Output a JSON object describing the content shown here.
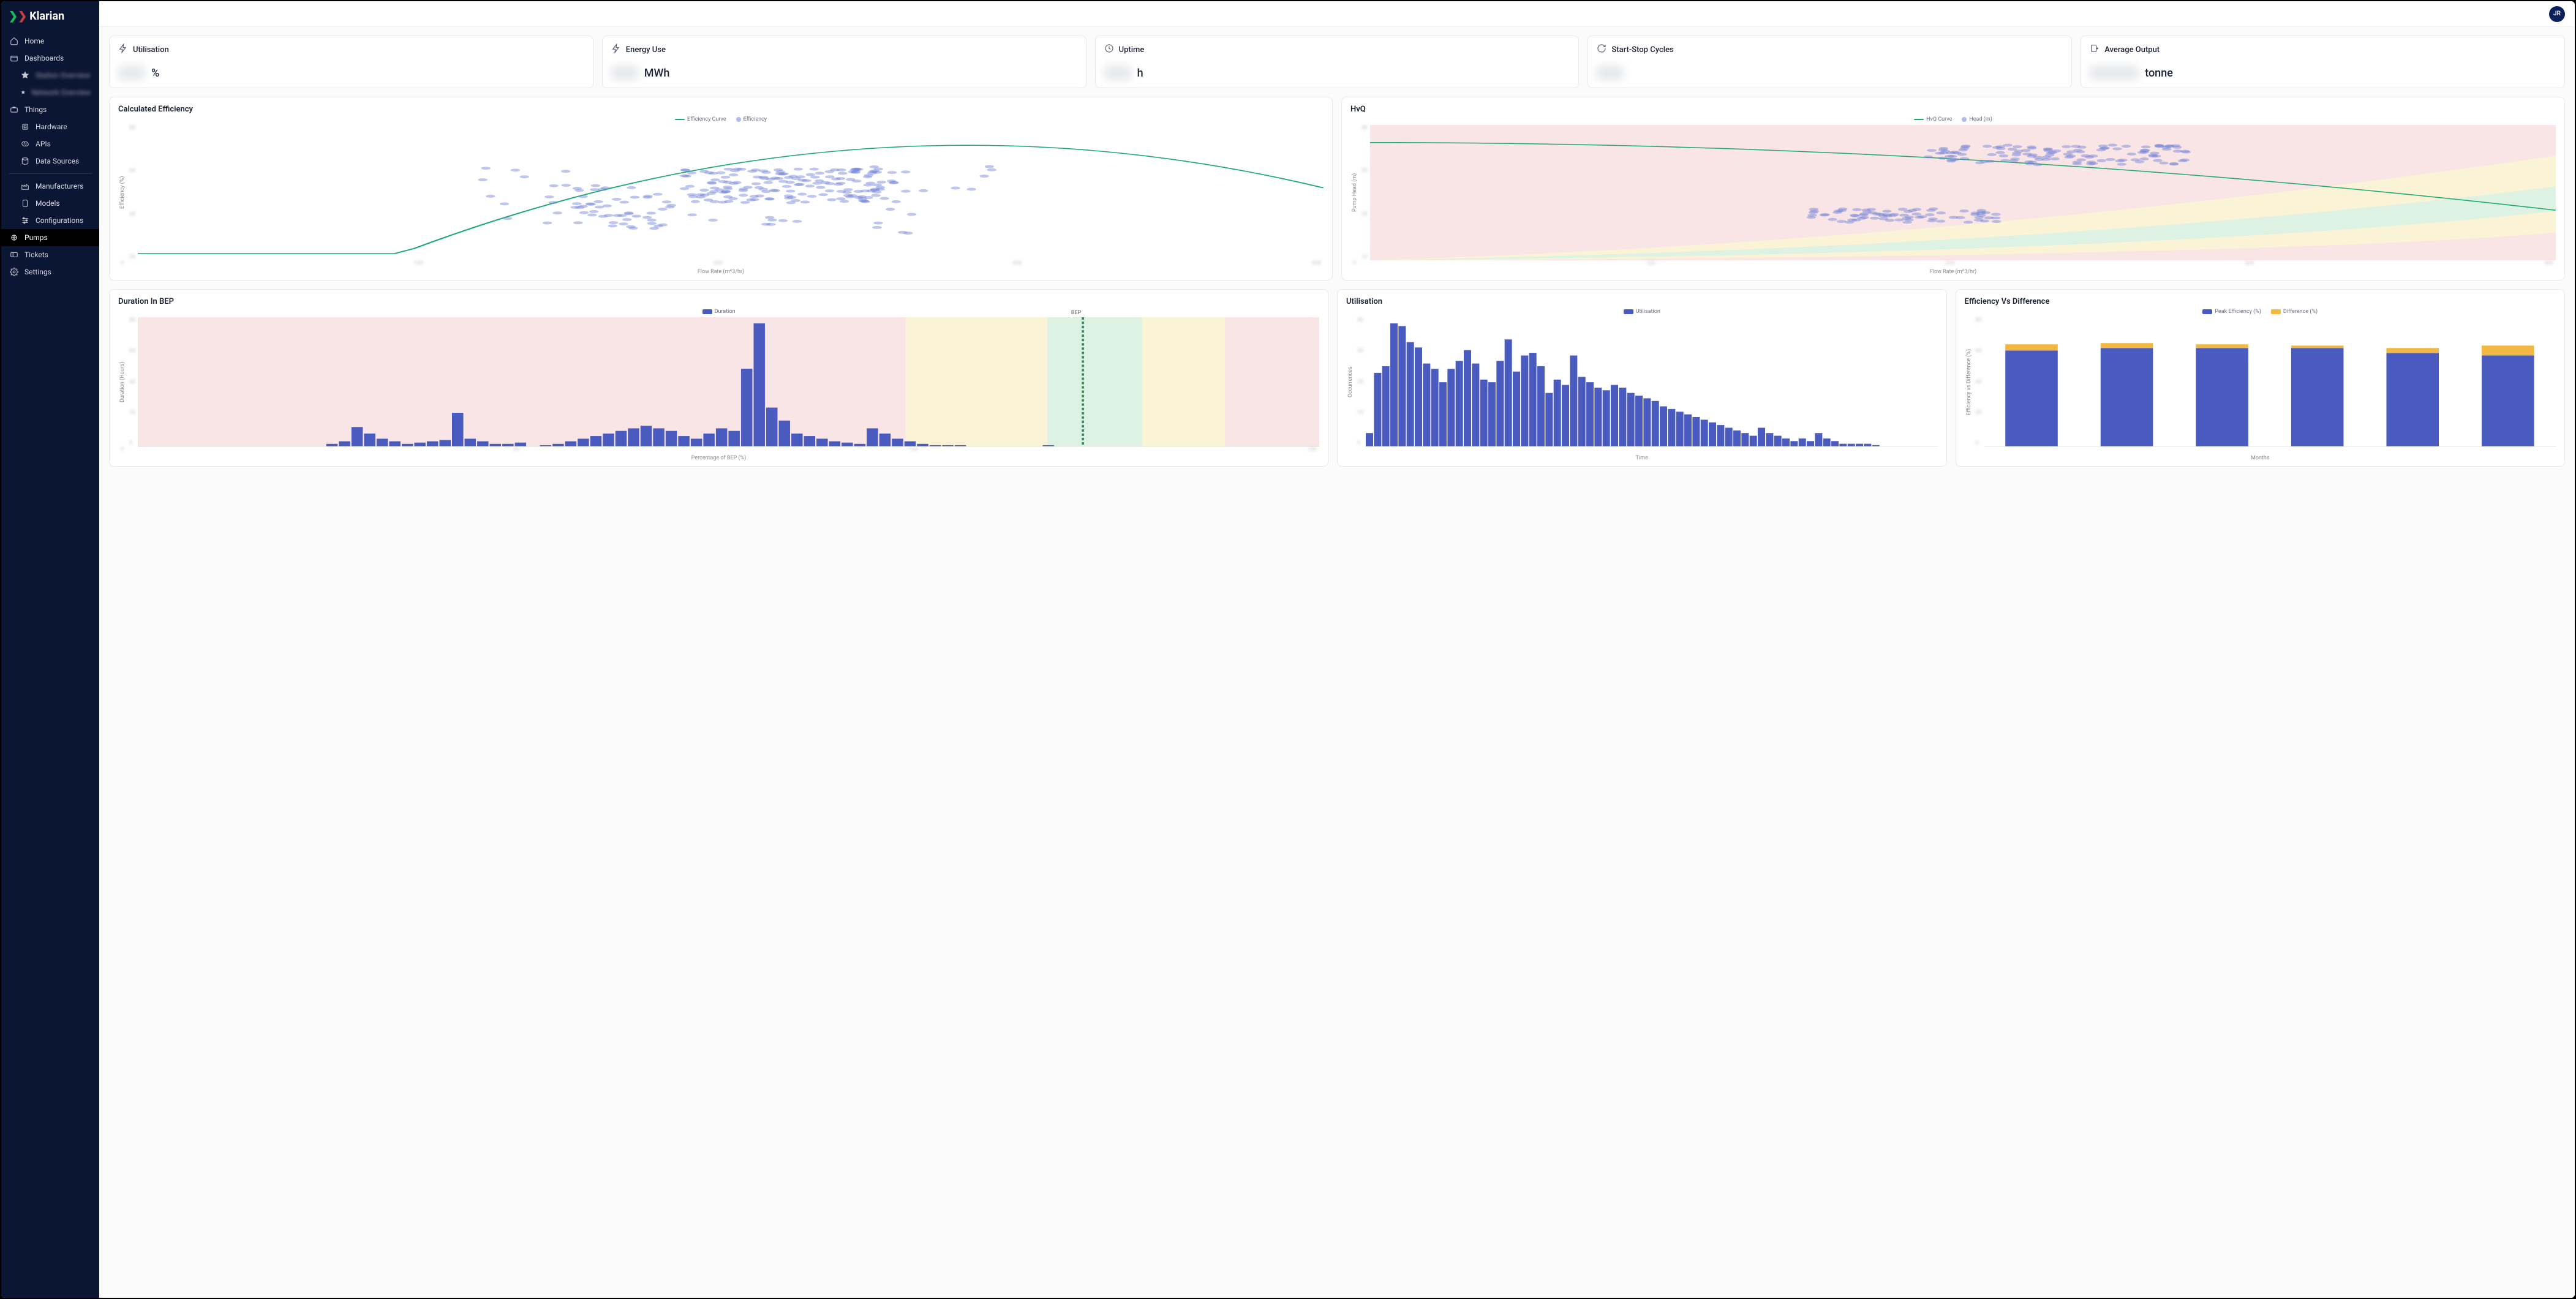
{
  "brand": "Klarian",
  "avatar_initials": "JR",
  "sidebar": {
    "items": [
      {
        "name": "home",
        "label": "Home"
      },
      {
        "name": "dashboards",
        "label": "Dashboards"
      },
      {
        "name": "dash-sub-1",
        "label": "Station Overview"
      },
      {
        "name": "dash-sub-2",
        "label": "Network Overview"
      },
      {
        "name": "things",
        "label": "Things"
      },
      {
        "name": "hardware",
        "label": "Hardware"
      },
      {
        "name": "apis",
        "label": "APIs"
      },
      {
        "name": "data-sources",
        "label": "Data Sources"
      },
      {
        "name": "manufacturers",
        "label": "Manufacturers"
      },
      {
        "name": "models",
        "label": "Models"
      },
      {
        "name": "configurations",
        "label": "Configurations"
      },
      {
        "name": "pumps",
        "label": "Pumps"
      },
      {
        "name": "tickets",
        "label": "Tickets"
      },
      {
        "name": "settings",
        "label": "Settings"
      }
    ]
  },
  "kpis": [
    {
      "name": "utilisation",
      "label": "Utilisation",
      "unit": "%"
    },
    {
      "name": "energy-use",
      "label": "Energy Use",
      "unit": "MWh"
    },
    {
      "name": "uptime",
      "label": "Uptime",
      "unit": "h"
    },
    {
      "name": "start-stop",
      "label": "Start-Stop Cycles",
      "unit": ""
    },
    {
      "name": "avg-output",
      "label": "Average Output",
      "unit": "tonne"
    }
  ],
  "charts": {
    "efficiency": {
      "title": "Calculated Efficiency",
      "legend": [
        {
          "type": "line",
          "color": "#1fa971",
          "label": "Efficiency Curve"
        },
        {
          "type": "dot",
          "color": "#7b8bdb",
          "label": "Efficiency"
        }
      ],
      "xlabel": "Flow Rate (m^3/hr)",
      "ylabel": "Efficiency (%)"
    },
    "hvq": {
      "title": "HvQ",
      "legend": [
        {
          "type": "line",
          "color": "#1fa971",
          "label": "HvQ Curve"
        },
        {
          "type": "dot",
          "color": "#7b8bdb",
          "label": "Head (m)"
        }
      ],
      "xlabel": "Flow Rate (m^3/hr)",
      "ylabel": "Pump Head (m)"
    },
    "duration_bep": {
      "title": "Duration In BEP",
      "legend": [
        {
          "type": "bar",
          "color": "#4a5bbf",
          "label": "Duration"
        }
      ],
      "bep_marker": "BEP",
      "xlabel": "Percentage of BEP (%)",
      "ylabel": "Duration (Hours)"
    },
    "utilisation_hist": {
      "title": "Utilisation",
      "legend": [
        {
          "type": "bar",
          "color": "#4a5bbf",
          "label": "Utilisation"
        }
      ],
      "xlabel": "Time",
      "ylabel": "Occurrences"
    },
    "eff_vs_diff": {
      "title": "Efficiency Vs Difference",
      "legend": [
        {
          "type": "bar",
          "color": "#4a5bbf",
          "label": "Peak Efficiency (%)"
        },
        {
          "type": "bar",
          "color": "#f2b844",
          "label": "Difference (%)"
        }
      ],
      "xlabel": "Months",
      "ylabel": "Efficiency vs Difference (%)"
    }
  },
  "chart_data": [
    {
      "id": "efficiency",
      "type": "scatter+line",
      "xlabel": "Flow Rate (m^3/hr)",
      "ylabel": "Efficiency (%)",
      "curve": {
        "name": "Efficiency Curve",
        "shape": "concave-down",
        "peak_x_frac": 0.7,
        "peak_y_frac": 0.8
      },
      "points_note": "dense cluster of Efficiency points roughly between 35%–65% flow at 40%–75% eff; exact values are blurred"
    },
    {
      "id": "hvq",
      "type": "scatter+line+bands",
      "xlabel": "Flow Rate (m^3/hr)",
      "ylabel": "Pump Head (m)",
      "curve": {
        "name": "HvQ Curve",
        "shape": "monotone-decreasing"
      },
      "bands": [
        "red-outer",
        "yellow-mid",
        "green-inner"
      ],
      "points_note": "two clusters: upper cluster ~55–75% flow near top of head range; lower cluster ~45–55% flow ~35% head; values blurred"
    },
    {
      "id": "duration_bep",
      "type": "bar-histogram",
      "xlabel": "Percentage of BEP (%)",
      "ylabel": "Duration (Hours)",
      "bep_marker_x_frac": 0.8,
      "bands": [
        {
          "color": "red",
          "range_frac": [
            0.0,
            0.65
          ]
        },
        {
          "color": "yellow",
          "range_frac": [
            0.65,
            0.77
          ]
        },
        {
          "color": "green",
          "range_frac": [
            0.77,
            0.85
          ]
        },
        {
          "color": "yellow",
          "range_frac": [
            0.85,
            0.92
          ]
        },
        {
          "color": "red",
          "range_frac": [
            0.92,
            1.0
          ]
        }
      ],
      "bars_rel": [
        0,
        0,
        0,
        0,
        0,
        0,
        0,
        0,
        0,
        0,
        0,
        0,
        0,
        0,
        0,
        2,
        4,
        15,
        10,
        6,
        4,
        2,
        3,
        4,
        5,
        26,
        6,
        4,
        2,
        2,
        3,
        0,
        1,
        2,
        4,
        6,
        8,
        10,
        12,
        14,
        16,
        14,
        12,
        8,
        6,
        10,
        14,
        12,
        60,
        95,
        30,
        20,
        10,
        8,
        6,
        4,
        3,
        2,
        14,
        10,
        6,
        4,
        2,
        1,
        1,
        1,
        0,
        0,
        0,
        0,
        0,
        0,
        1,
        0,
        0,
        0,
        0,
        0,
        0,
        0,
        0,
        0,
        0,
        0,
        0,
        0,
        0,
        0,
        0,
        0,
        0,
        0,
        0,
        0
      ],
      "values_note": "bar heights are relative estimates; axis tick values are blurred"
    },
    {
      "id": "utilisation_hist",
      "type": "bar-histogram",
      "xlabel": "Time",
      "ylabel": "Occurrences",
      "bars_rel": [
        10,
        55,
        60,
        92,
        90,
        78,
        74,
        62,
        58,
        48,
        58,
        64,
        72,
        62,
        50,
        48,
        64,
        80,
        56,
        68,
        70,
        60,
        40,
        50,
        46,
        68,
        52,
        48,
        44,
        42,
        46,
        44,
        40,
        38,
        36,
        34,
        30,
        28,
        26,
        24,
        22,
        20,
        18,
        16,
        14,
        12,
        10,
        8,
        14,
        10,
        8,
        6,
        4,
        6,
        4,
        10,
        6,
        4,
        2,
        2,
        2,
        2,
        1,
        0,
        0,
        0,
        0,
        0,
        0,
        0
      ],
      "values_note": "bar heights are relative estimates; axis tick values are blurred"
    },
    {
      "id": "eff_vs_diff",
      "type": "stacked-bar",
      "xlabel": "Months",
      "ylabel": "Efficiency vs Difference (%)",
      "categories_count": 6,
      "series": [
        {
          "name": "Peak Efficiency (%)",
          "values_rel": [
            78,
            80,
            80,
            80,
            76,
            74
          ]
        },
        {
          "name": "Difference (%)",
          "values_rel": [
            5,
            4,
            3,
            2,
            4,
            8
          ]
        }
      ],
      "values_note": "approximate; month labels and axis ticks are blurred"
    }
  ]
}
